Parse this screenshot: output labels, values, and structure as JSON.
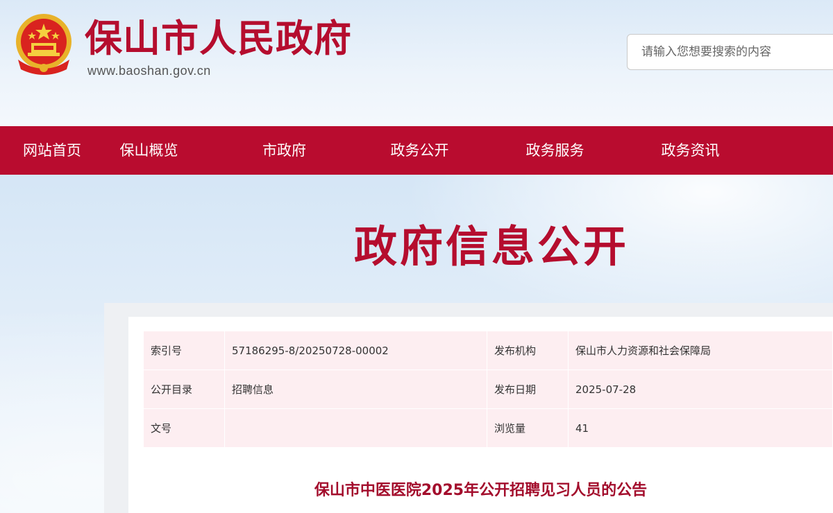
{
  "header": {
    "site_title": "保山市人民政府",
    "site_url": "www.baoshan.gov.cn",
    "search_placeholder": "请输入您想要搜索的内容",
    "emblem_icon": "national-emblem-icon"
  },
  "nav": {
    "items": [
      {
        "label": "网站首页"
      },
      {
        "label": "保山概览"
      },
      {
        "label": "市政府"
      },
      {
        "label": "政务公开"
      },
      {
        "label": "政务服务"
      },
      {
        "label": "政务资讯"
      }
    ]
  },
  "hero": {
    "title": "政府信息公开"
  },
  "meta": {
    "rows": [
      {
        "k1": "索引号",
        "v1": "57186295-8/20250728-00002",
        "k2": "发布机构",
        "v2": "保山市人力资源和社会保障局"
      },
      {
        "k1": "公开目录",
        "v1": "招聘信息",
        "k2": "发布日期",
        "v2": "2025-07-28"
      },
      {
        "k1": "文号",
        "v1": "",
        "k2": "浏览量",
        "v2": "41"
      }
    ]
  },
  "article": {
    "title": "保山市中医医院2025年公开招聘见习人员的公告"
  },
  "colors": {
    "brand_red": "#b90c2f",
    "title_red": "#b50d2e",
    "table_bg": "#fdeef1"
  }
}
